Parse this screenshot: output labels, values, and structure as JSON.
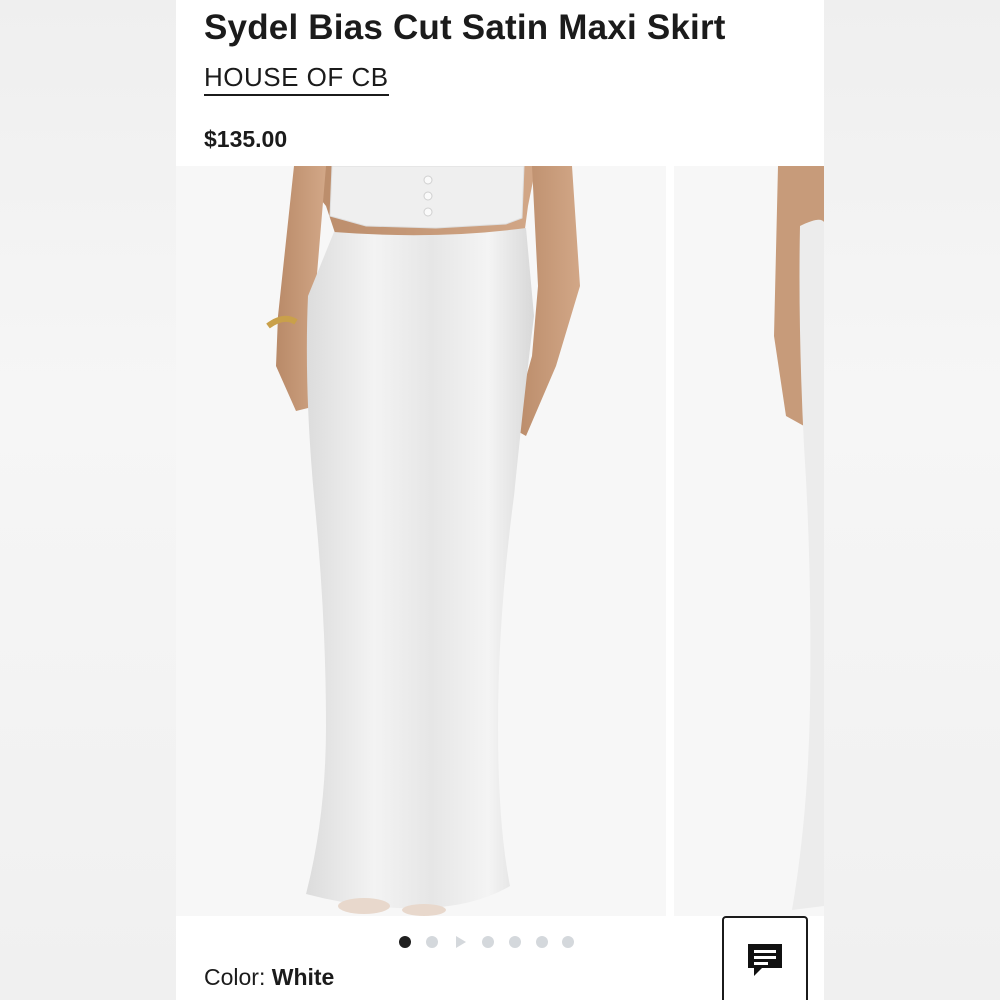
{
  "product": {
    "title": "Sydel Bias Cut Satin Maxi Skirt",
    "brand": "HOUSE OF CB",
    "price": "$135.00"
  },
  "carousel": {
    "image_count": 7,
    "active_index": 0,
    "video_index": 2,
    "images": [
      {
        "icon": "skirt-front-photo"
      },
      {
        "icon": "skirt-side-photo"
      }
    ]
  },
  "color": {
    "label": "Color: ",
    "value": "White"
  },
  "chat": {
    "icon": "chat-icon"
  },
  "colors": {
    "background": "#ffffff",
    "text": "#1b1b1b",
    "dot_inactive": "#d4d8dc",
    "dot_active": "#1f1f1f",
    "skirt": "#ebebeb"
  }
}
